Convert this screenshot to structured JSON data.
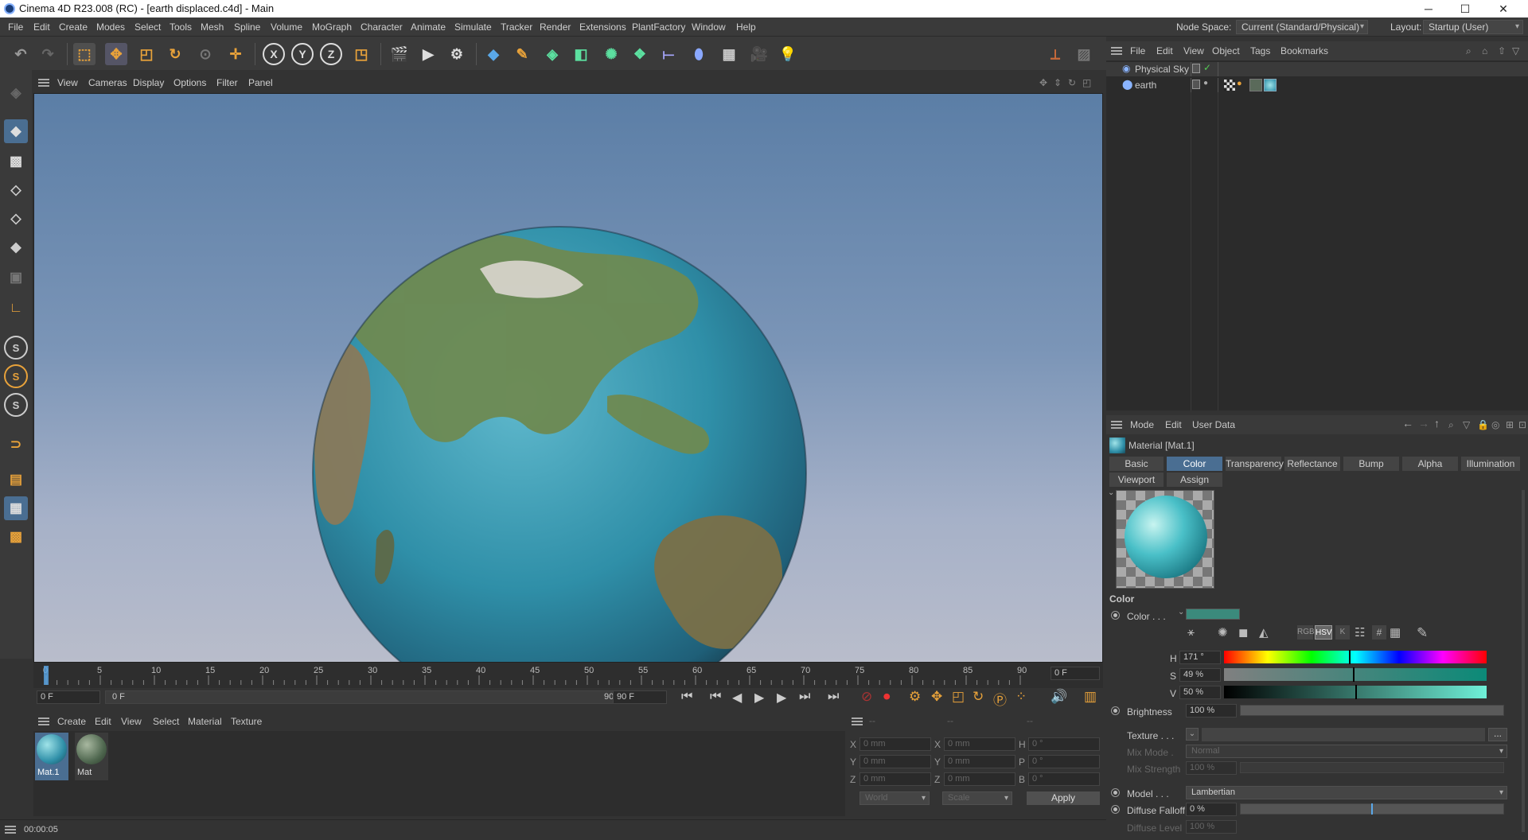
{
  "titlebar": {
    "title": "Cinema 4D R23.008 (RC) - [earth displaced.c4d] - Main"
  },
  "menubar": {
    "items": [
      "File",
      "Edit",
      "Create",
      "Modes",
      "Select",
      "Tools",
      "Mesh",
      "Spline",
      "Volume",
      "MoGraph",
      "Character",
      "Animate",
      "Simulate",
      "Tracker",
      "Render",
      "Extensions",
      "PlantFactory",
      "Window",
      "Help"
    ],
    "node_space_label": "Node Space:",
    "node_space_value": "Current (Standard/Physical)",
    "layout_label": "Layout:",
    "layout_value": "Startup (User)"
  },
  "toolbar": {
    "axis_x": "X",
    "axis_y": "Y",
    "axis_z": "Z"
  },
  "viewport_menu": {
    "items": [
      "View",
      "Cameras",
      "Display",
      "Options",
      "Filter",
      "Panel"
    ]
  },
  "timeline": {
    "ticks": [
      "0",
      "5",
      "10",
      "15",
      "20",
      "25",
      "30",
      "35",
      "40",
      "45",
      "50",
      "55",
      "60",
      "65",
      "70",
      "75",
      "80",
      "85",
      "90"
    ],
    "current_frame": "0 F",
    "start_field": "0 F",
    "range_start": "0 F",
    "range_end": "90 F",
    "end_field": "90 F"
  },
  "material_manager": {
    "menu": [
      "Create",
      "Edit",
      "View",
      "Select",
      "Material",
      "Texture"
    ],
    "materials": [
      {
        "name": "Mat.1"
      },
      {
        "name": "Mat"
      }
    ]
  },
  "coordinates": {
    "rows": [
      {
        "a": "X",
        "av": "0 mm",
        "b": "X",
        "bv": "0 mm",
        "c": "H",
        "cv": "0 °"
      },
      {
        "a": "Y",
        "av": "0 mm",
        "b": "Y",
        "bv": "0 mm",
        "c": "P",
        "cv": "0 °"
      },
      {
        "a": "Z",
        "av": "0 mm",
        "b": "Z",
        "bv": "0 mm",
        "c": "B",
        "cv": "0 °"
      }
    ],
    "mode1": "World",
    "mode2": "Scale",
    "apply": "Apply",
    "headers": [
      "--",
      "--",
      "--"
    ]
  },
  "statusbar": {
    "time": "00:00:05"
  },
  "object_manager": {
    "menu": [
      "File",
      "Edit",
      "View",
      "Object",
      "Tags",
      "Bookmarks"
    ],
    "objects": [
      {
        "name": "Physical Sky"
      },
      {
        "name": "earth"
      }
    ]
  },
  "attributes": {
    "menu": [
      "Mode",
      "Edit",
      "User Data"
    ],
    "material_title": "Material [Mat.1]",
    "tabs_row1": [
      "Basic",
      "Color",
      "Transparency",
      "Reflectance",
      "Bump",
      "Alpha",
      "Illumination"
    ],
    "tabs_row2": [
      "Viewport",
      "Assign"
    ],
    "section": "Color",
    "color_label": "Color . . .",
    "color_swatch": "#3b8a7c",
    "mode_buttons": [
      "RGB",
      "HSV",
      "K",
      "#"
    ],
    "h_label": "H",
    "h_value": "171 °",
    "h_fraction": 0.475,
    "s_label": "S",
    "s_value": "49 %",
    "s_fraction": 0.49,
    "v_label": "V",
    "v_value": "50 %",
    "v_fraction": 0.5,
    "brightness_label": "Brightness",
    "brightness_value": "100 %",
    "texture_label": "Texture . . .",
    "texture_btn": "...",
    "mix_mode_label": "Mix Mode .",
    "mix_mode_value": "Normal",
    "mix_strength_label": "Mix Strength",
    "mix_strength_value": "100 %",
    "model_label": "Model . . .",
    "model_value": "Lambertian",
    "diffuse_falloff_label": "Diffuse Falloff",
    "diffuse_falloff_value": "0 %",
    "diffuse_level_label": "Diffuse Level",
    "diffuse_level_value": "100 %"
  },
  "colors": {
    "accent": "#e8a23a",
    "active_tab": "#4a6e92",
    "ocean": "#2f8fa8",
    "land": "#6e8a52"
  }
}
